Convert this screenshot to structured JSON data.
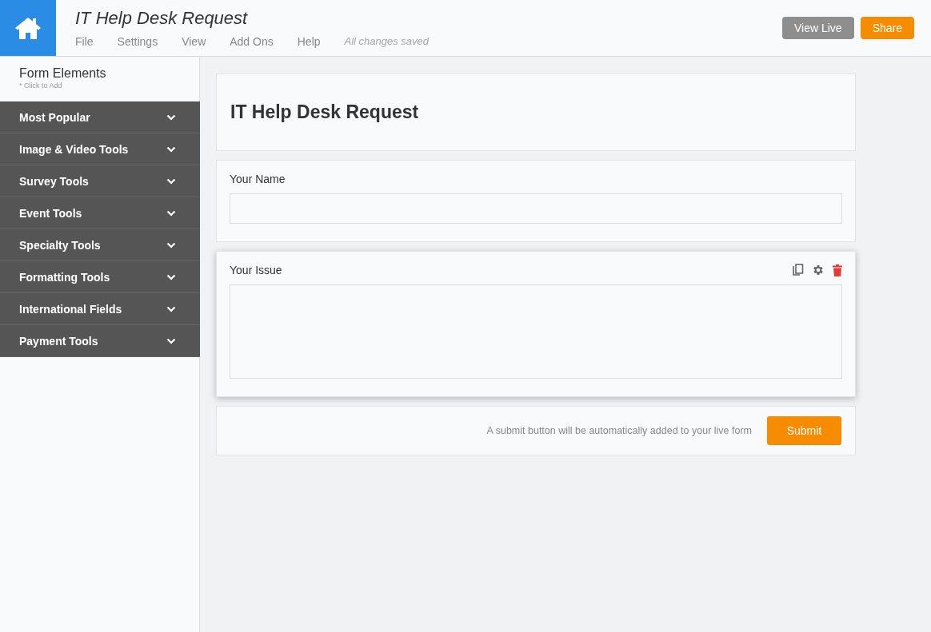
{
  "header": {
    "title": "IT Help Desk Request",
    "menu": [
      "File",
      "Settings",
      "View",
      "Add Ons",
      "Help"
    ],
    "save_status": "All changes saved",
    "buttons": [
      {
        "label": "View Live",
        "kind": "secondary"
      },
      {
        "label": "Share",
        "kind": "primary"
      }
    ]
  },
  "sidebar": {
    "title": "Form Elements",
    "hint": "* Click to Add",
    "sections": [
      {
        "label": "Most Popular",
        "expanded": false
      },
      {
        "label": "Image & Video Tools",
        "expanded": false
      },
      {
        "label": "Survey Tools",
        "expanded": false
      },
      {
        "label": "Event Tools",
        "expanded": false
      },
      {
        "label": "Specialty Tools",
        "expanded": false
      },
      {
        "label": "Formatting Tools",
        "expanded": false
      },
      {
        "label": "International Fields",
        "expanded": false
      },
      {
        "label": "Payment Tools",
        "expanded": false
      }
    ]
  },
  "form": {
    "heading": "IT Help Desk Request",
    "fields": [
      {
        "label": "Your Name",
        "kind": "input",
        "selected": false
      },
      {
        "label": "Your Issue",
        "kind": "textarea",
        "selected": true
      }
    ],
    "submit_note": "A submit button will be automatically added to your live form",
    "submit_label": "Submit"
  }
}
